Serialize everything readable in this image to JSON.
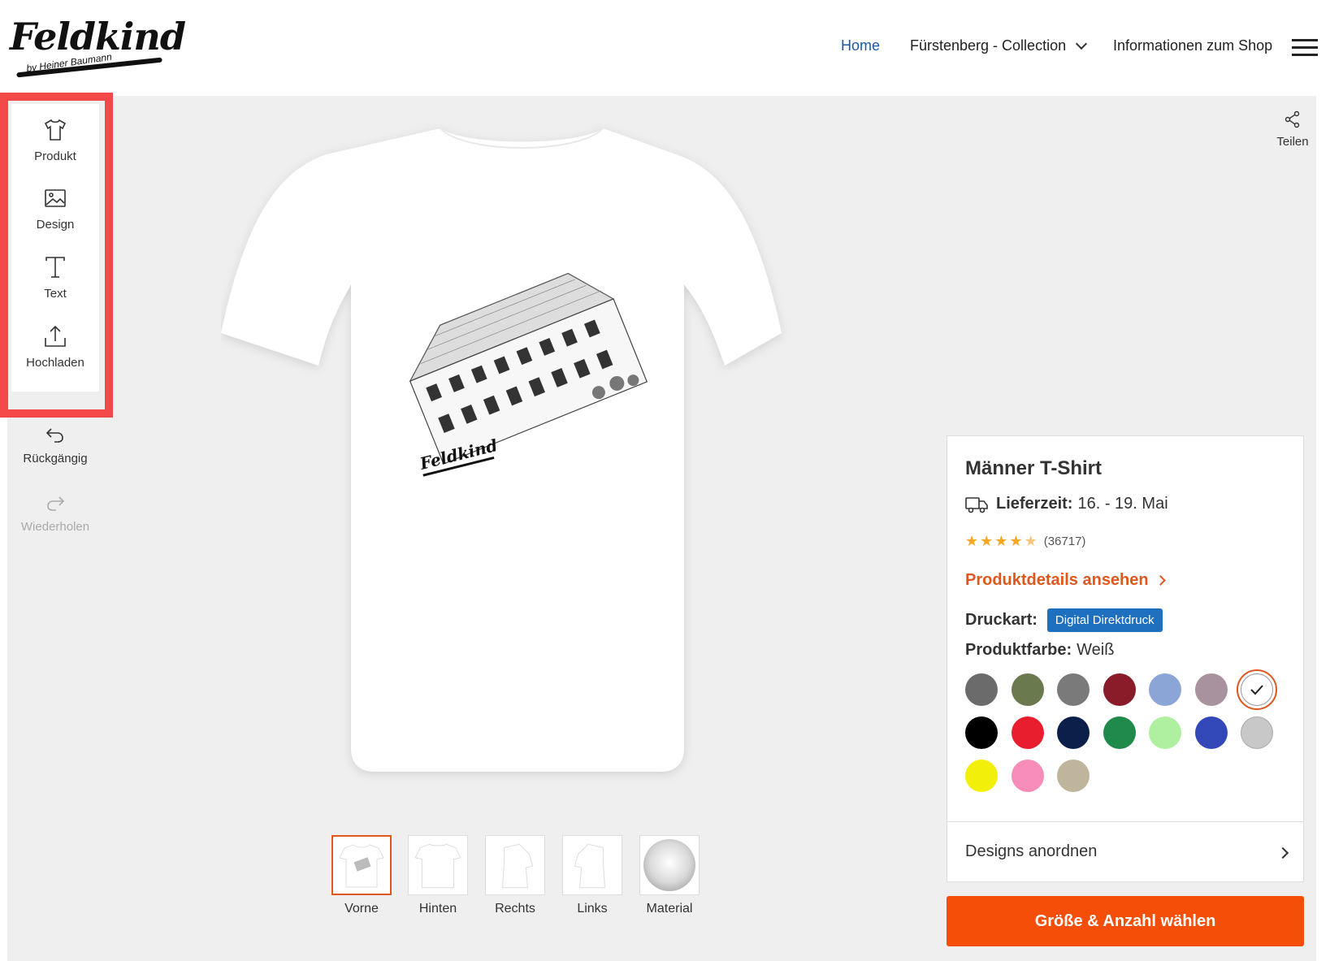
{
  "header": {
    "logo_text": "Feldkind",
    "logo_sub": "by Heiner Baumann",
    "nav": [
      {
        "label": "Home"
      },
      {
        "label": "Fürstenberg - Collection"
      },
      {
        "label": "Informationen zum Shop"
      }
    ]
  },
  "toolbar": {
    "items": [
      {
        "label": "Produkt",
        "icon": "tshirt-icon"
      },
      {
        "label": "Design",
        "icon": "image-icon"
      },
      {
        "label": "Text",
        "icon": "text-icon"
      },
      {
        "label": "Hochladen",
        "icon": "upload-icon"
      }
    ],
    "undo": {
      "label": "Rückgängig",
      "icon": "undo-icon"
    },
    "redo": {
      "label": "Wiederholen",
      "icon": "redo-icon"
    }
  },
  "share": {
    "label": "Teilen",
    "icon": "share-icon"
  },
  "preview": {
    "design_text": "Feldkind",
    "views": [
      {
        "label": "Vorne"
      },
      {
        "label": "Hinten"
      },
      {
        "label": "Rechts"
      },
      {
        "label": "Links"
      },
      {
        "label": "Material"
      }
    ],
    "selected_view": "Vorne"
  },
  "product": {
    "title": "Männer T-Shirt",
    "delivery_label": "Lieferzeit:",
    "delivery_value": "16. - 19. Mai",
    "rating": 4.5,
    "rating_count": "(36717)",
    "details_link": "Produktdetails ansehen",
    "print_label": "Druckart:",
    "print_value": "Digital Direktdruck",
    "color_label": "Produktfarbe:",
    "color_value": "Weiß",
    "colors": [
      "#6b6b6b",
      "#6a7a4e",
      "#7a7a7a",
      "#8a1c2a",
      "#8ba5d6",
      "#a8929e",
      "#ffffff",
      "#000000",
      "#e81e2e",
      "#0c1f4a",
      "#1f8a4a",
      "#aef0a0",
      "#3348b8",
      "#c8c8c8",
      "#f2ef0a",
      "#f58db8",
      "#bfb49c"
    ],
    "arrange_label": "Designs anordnen",
    "cta_label": "Größe & Anzahl wählen"
  },
  "colors": {
    "accent": "#e0571e",
    "cta": "#f54e09",
    "link": "#1a5aa8",
    "badge": "#1f6fbf",
    "highlight": "#f24848"
  }
}
